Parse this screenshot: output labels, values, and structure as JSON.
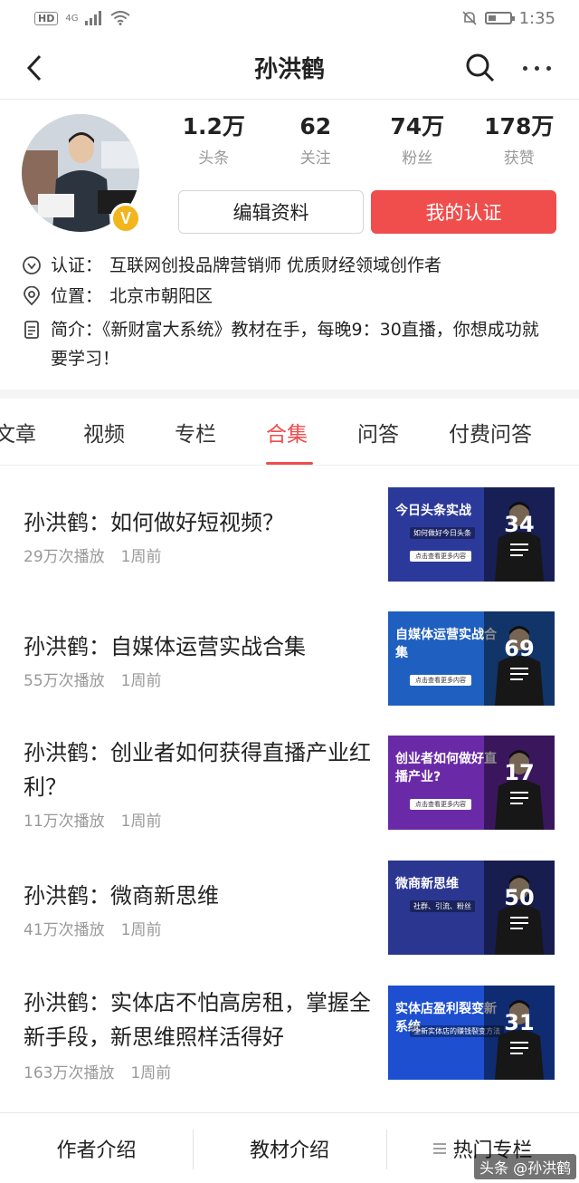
{
  "status_bar": {
    "network_badge": "HD",
    "signal_label": "4G",
    "time": "1:35"
  },
  "nav": {
    "title": "孙洪鹤"
  },
  "profile": {
    "stats": [
      {
        "value": "1.2万",
        "label": "头条"
      },
      {
        "value": "62",
        "label": "关注"
      },
      {
        "value": "74万",
        "label": "粉丝"
      },
      {
        "value": "178万",
        "label": "获赞"
      }
    ],
    "verified_badge": "V",
    "edit_button": "编辑资料",
    "cert_button": "我的认证",
    "cert_label": "认证：",
    "cert_text": "互联网创投品牌营销师 优质财经领域创作者",
    "location_label": "位置：",
    "location_text": "北京市朝阳区",
    "bio_label": "简介：",
    "bio_text": "《新财富大系统》教材在手，每晚9：30直播，你想成功就要学习！"
  },
  "tabs": [
    "文章",
    "视频",
    "专栏",
    "合集",
    "问答",
    "付费问答"
  ],
  "active_tab": "合集",
  "collections": [
    {
      "title": "孙洪鹤：如何做好短视频？",
      "plays": "29万次播放",
      "time": "1周前",
      "count": "34",
      "thumb_text": "今日头条实战",
      "thumb_sub": "如何做好今日头条",
      "thumb_pill": "点击查看更多内容",
      "thumb_bg": "#2b3a9a"
    },
    {
      "title": "孙洪鹤：自媒体运营实战合集",
      "plays": "55万次播放",
      "time": "1周前",
      "count": "69",
      "thumb_text": "自媒体运营实战合集",
      "thumb_sub": "",
      "thumb_pill": "点击查看更多内容",
      "thumb_bg": "#1f5fc0"
    },
    {
      "title": "孙洪鹤：创业者如何获得直播产业红利？",
      "plays": "11万次播放",
      "time": "1周前",
      "count": "17",
      "thumb_text": "创业者如何做好直播产业?",
      "thumb_sub": "",
      "thumb_pill": "点击查看更多内容",
      "thumb_bg": "#6a2aa8"
    },
    {
      "title": "孙洪鹤：微商新思维",
      "plays": "41万次播放",
      "time": "1周前",
      "count": "50",
      "thumb_text": "微商新思维",
      "thumb_sub": "社群、引流、粉丝",
      "thumb_pill": "",
      "thumb_bg": "#2a3690"
    },
    {
      "title": "孙洪鹤：实体店不怕高房租，掌握全新手段，新思维照样活得好",
      "plays": "163万次播放",
      "time": "1周前",
      "count": "31",
      "thumb_text": "实体店盈利裂变新系统",
      "thumb_sub": "全新实体店的赚钱裂变方法",
      "thumb_pill": "",
      "thumb_bg": "#1d4fd0"
    }
  ],
  "bottom_bar": {
    "author": "作者介绍",
    "materials": "教材介绍",
    "hot": "热门专栏"
  },
  "watermark": "头条 @孙洪鹤",
  "colors": {
    "accent": "#f04d4d",
    "badge": "#f2b51c"
  }
}
